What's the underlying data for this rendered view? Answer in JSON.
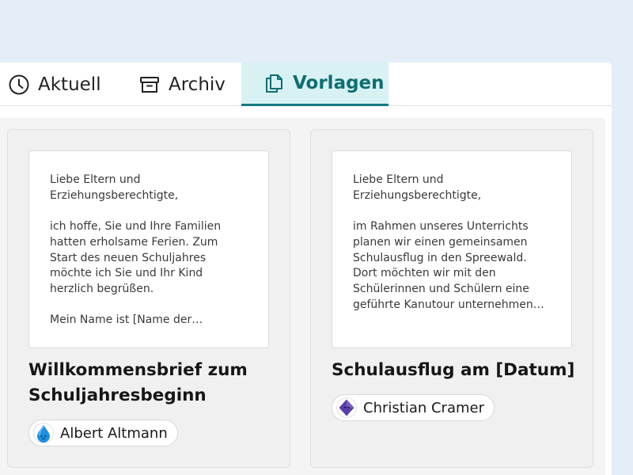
{
  "tabs": [
    {
      "label": "Aktuell",
      "icon": "clock-icon",
      "active": false
    },
    {
      "label": "Archiv",
      "icon": "archive-icon",
      "active": false
    },
    {
      "label": "Vorlagen",
      "icon": "copy-icon",
      "active": true
    }
  ],
  "cards": [
    {
      "preview": [
        "Liebe Eltern und Erziehungsberechtigte,",
        "ich hoffe, Sie und Ihre Familien hatten erholsame Ferien. Zum Start des neuen Schuljahres möchte ich Sie und Ihr Kind herzlich begrüßen.",
        "Mein Name ist [Name der Lehrkraft] und ich werde in diesem Schuljahr die Klasse unterrichten."
      ],
      "title": "Willkommensbrief zum Schuljahresbeginn",
      "author": "Albert Altmann",
      "avatar_icon": "water-drop-avatar-icon"
    },
    {
      "preview": [
        "Liebe Eltern und Erziehungsberechtigte,",
        "im Rahmen unseres Unterrichts planen wir einen gemeinsamen Schulausflug in den Spreewald. Dort möchten wir mit den Schülerinnen und Schülern eine geführte Kanutour unternehmen und die Natur aus eine ..."
      ],
      "title": "Schulausflug am [Datum]",
      "author": "Christian Cramer",
      "avatar_icon": "diamond-avatar-icon"
    }
  ],
  "colors": {
    "background": "#e3eef8",
    "active_tab_bg": "#d8f2f4",
    "active_tab_text": "#0d6e73",
    "active_tab_border": "#127a80"
  }
}
